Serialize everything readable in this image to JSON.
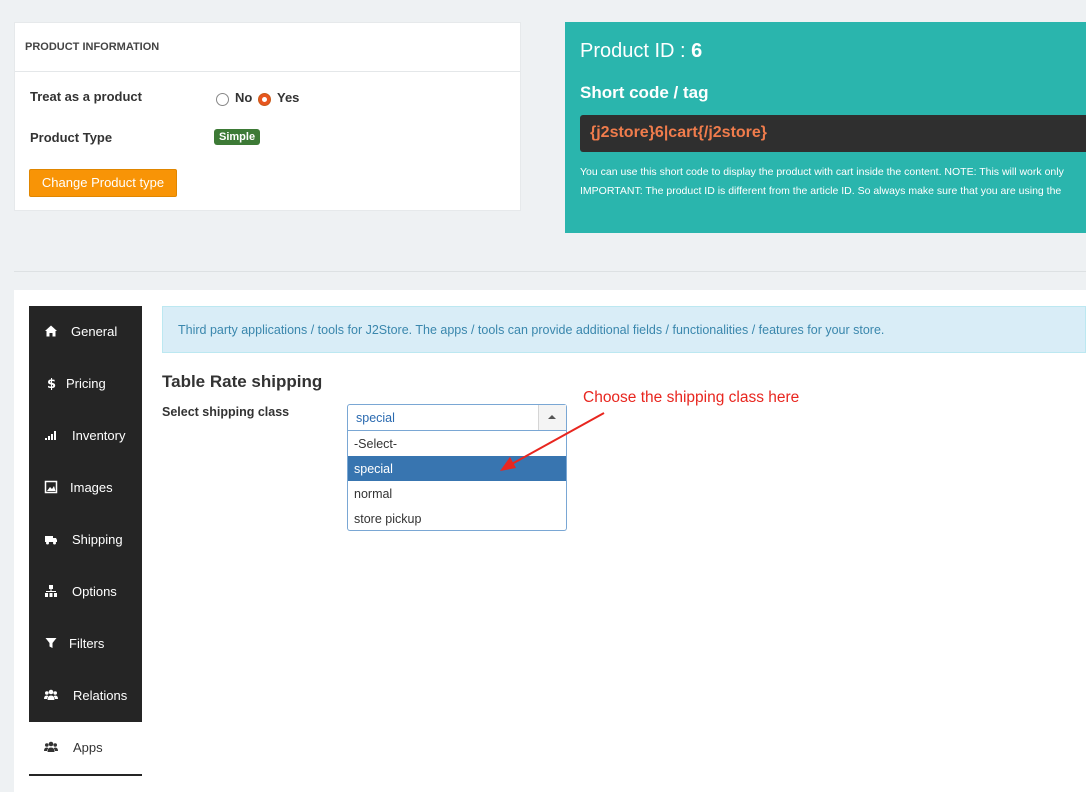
{
  "product_info": {
    "title": "PRODUCT INFORMATION",
    "treat_label": "Treat as a product",
    "treat_options": [
      "No",
      "Yes"
    ],
    "treat_selected": "Yes",
    "type_label": "Product Type",
    "type_value": "Simple",
    "change_button": "Change Product type"
  },
  "product_id": {
    "label": "Product ID : ",
    "value": "6",
    "shortcode_title": "Short code / tag",
    "shortcode": "{j2store}6|cart{/j2store}",
    "note_line1": "You can use this short code to display the product with cart inside the content. NOTE: This will work only",
    "note_line2": "IMPORTANT: The product ID is different from the article ID. So always make sure that you are using the"
  },
  "sidebar": {
    "items": [
      {
        "label": "General",
        "icon": "home-icon"
      },
      {
        "label": "Pricing",
        "icon": "dollar-icon"
      },
      {
        "label": "Inventory",
        "icon": "signal-icon"
      },
      {
        "label": "Images",
        "icon": "image-icon"
      },
      {
        "label": "Shipping",
        "icon": "truck-icon"
      },
      {
        "label": "Options",
        "icon": "sitemap-icon"
      },
      {
        "label": "Filters",
        "icon": "filter-icon"
      },
      {
        "label": "Relations",
        "icon": "users-icon"
      },
      {
        "label": "Apps",
        "icon": "users-icon"
      }
    ],
    "active": "Apps"
  },
  "apps": {
    "info": "Third party applications / tools for J2Store. The apps / tools can provide additional fields / functionalities / features for your store.",
    "title": "Table Rate shipping",
    "shipping_label": "Select shipping class",
    "select_value": "special",
    "options": [
      "-Select-",
      "special",
      "normal",
      "store pickup"
    ],
    "highlighted": "special"
  },
  "annotation": "Choose the shipping class here",
  "colors": {
    "teal": "#2ab5ad",
    "sidebar": "#252525",
    "orange": "#f89406",
    "annotation_red": "#e8261f",
    "highlight_blue": "#3875b0"
  }
}
